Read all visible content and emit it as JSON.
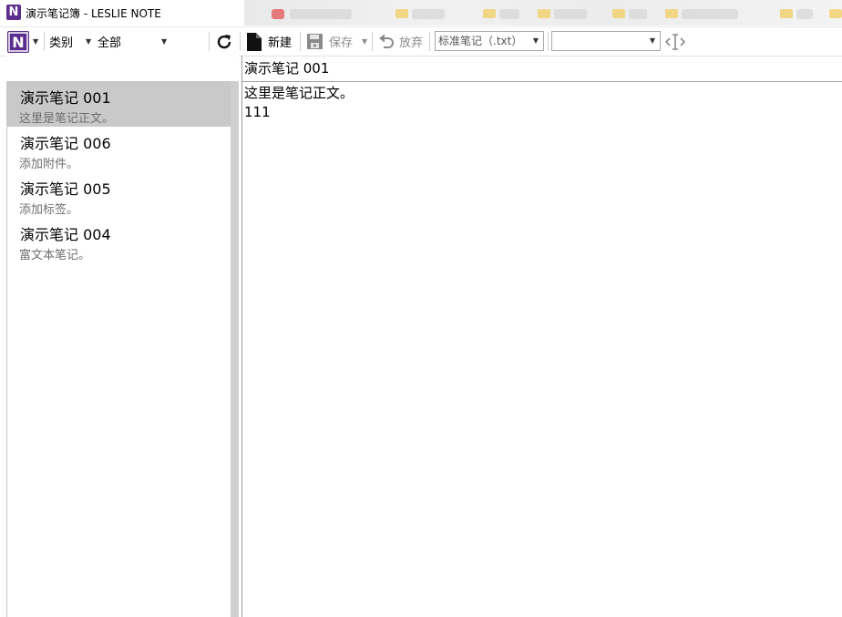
{
  "window": {
    "title": "演示笔记簿 - LESLIE NOTE"
  },
  "toolbar": {
    "category_label": "类别",
    "category_value": "全部",
    "new_label": "新建",
    "save_label": "保存",
    "discard_label": "放弃",
    "note_type_value": "标准笔记（.txt）",
    "tag_value": ""
  },
  "note_list": [
    {
      "title": "演示笔记 001",
      "preview": "这里是笔记正文。",
      "selected": true
    },
    {
      "title": "演示笔记 006",
      "preview": "添加附件。",
      "selected": false
    },
    {
      "title": "演示笔记 005",
      "preview": "添加标签。",
      "selected": false
    },
    {
      "title": "演示笔记 004",
      "preview": "富文本笔记。",
      "selected": false
    }
  ],
  "editor": {
    "title": "演示笔记 001",
    "body": "这里是笔记正文。\n111"
  },
  "colors": {
    "brand": "#5b2d8e",
    "selection": "#c9c9c9",
    "muted_text": "#6e6e6e",
    "disabled_text": "#8c8c8c"
  },
  "icons": {
    "app": "notebook-logo-icon",
    "refresh": "refresh-icon",
    "new": "new-document-icon",
    "save": "save-disk-icon",
    "discard": "undo-icon",
    "cursor": "text-cursor-icon"
  }
}
